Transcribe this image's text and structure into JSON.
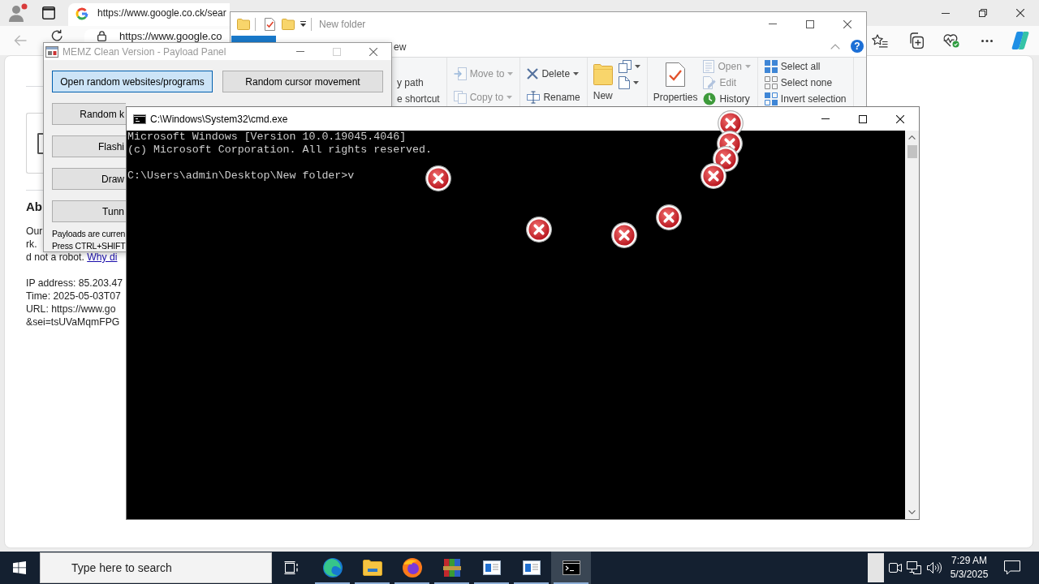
{
  "browser": {
    "tabs": [
      {
        "title": "https://www.google.co.ck/sear",
        "selected": true
      }
    ],
    "back_disabled": true,
    "address": "https://www.google.co",
    "page": {
      "captcha_checked": false,
      "heading": "Ab",
      "lines": [
        "Our",
        "rk."
      ],
      "robot_line": {
        "text": "d not a robot.",
        "link": "Why di"
      },
      "details": [
        "IP address: 85.203.47",
        "Time: 2025-05-03T07",
        "URL: https://www.go",
        "&sei=tsUVaMqmFPG"
      ]
    }
  },
  "explorer": {
    "title": "New folder",
    "tabs": [
      {
        "label": "ew",
        "selected": false
      }
    ],
    "help": "?",
    "ribbon_groups": [
      {
        "small": [
          {
            "label": "y path",
            "disabled": false
          },
          {
            "label": "e shortcut",
            "disabled": false
          }
        ]
      },
      {
        "small": [
          {
            "kind": "move",
            "label": "Move to",
            "dropdown": true,
            "disabled": true
          },
          {
            "kind": "copy",
            "label": "Copy to",
            "dropdown": true,
            "disabled": true
          }
        ]
      },
      {
        "small": [
          {
            "kind": "delete",
            "label": "Delete",
            "dropdown": true,
            "disabled": false
          },
          {
            "kind": "rename",
            "label": "Rename",
            "dropdown": false,
            "disabled": false
          }
        ]
      },
      {
        "large": {
          "kind": "folder",
          "label": "New",
          "disabled": false
        },
        "small": [
          {
            "kind": "newitem",
            "dropdown": true,
            "disabled": false
          },
          {
            "kind": "access",
            "dropdown": true,
            "disabled": false
          }
        ]
      },
      {
        "large": {
          "kind": "properties",
          "label": "Properties",
          "disabled": false
        },
        "small": [
          {
            "kind": "open",
            "label": "Open",
            "dropdown": true,
            "disabled": true
          },
          {
            "kind": "edit",
            "label": "Edit",
            "dropdown": false,
            "disabled": true
          },
          {
            "kind": "history",
            "label": "History",
            "dropdown": false,
            "disabled": false
          }
        ]
      },
      {
        "small": [
          {
            "kind": "selectall",
            "label": "Select all",
            "disabled": false
          },
          {
            "kind": "selectnone",
            "label": "Select none",
            "disabled": false
          },
          {
            "kind": "invert",
            "label": "Invert selection",
            "disabled": false
          }
        ]
      }
    ]
  },
  "memz": {
    "title": "MEMZ Clean Version - Payload Panel",
    "maximize_disabled": true,
    "buttons": [
      {
        "label": "Open random websites/programs",
        "selected": true
      },
      {
        "label": "Random cursor movement",
        "selected": false
      },
      {
        "label": "Random k",
        "selected": false
      },
      {
        "label": "Flashi",
        "selected": false
      },
      {
        "label": "Draw",
        "selected": false
      },
      {
        "label": "Tunn",
        "selected": false
      }
    ],
    "notes": [
      "Payloads are curren",
      "Press CTRL+SHIFT"
    ]
  },
  "cmd": {
    "title": "C:\\Windows\\System32\\cmd.exe",
    "blocks": [
      [
        "Microsoft Windows [Version 10.0.19045.4046]",
        "(c) Microsoft Corporation. All rights reserved."
      ],
      [
        "C:\\Users\\admin\\Desktop\\New folder>v"
      ]
    ]
  },
  "taskbar": {
    "search": {
      "placeholder": "Type here to search"
    },
    "apps": [
      {
        "kind": "browser",
        "running": true,
        "active": false
      },
      {
        "kind": "folder",
        "running": true,
        "active": false
      },
      {
        "kind": "fox",
        "running": true,
        "active": false
      },
      {
        "kind": "archive",
        "running": true,
        "active": false
      },
      {
        "kind": "window",
        "running": true,
        "active": false
      },
      {
        "kind": "window",
        "running": true,
        "active": false
      },
      {
        "kind": "terminal",
        "running": true,
        "active": true
      }
    ],
    "clock": {
      "time": "7:29 AM",
      "date": "5/3/2025"
    }
  }
}
